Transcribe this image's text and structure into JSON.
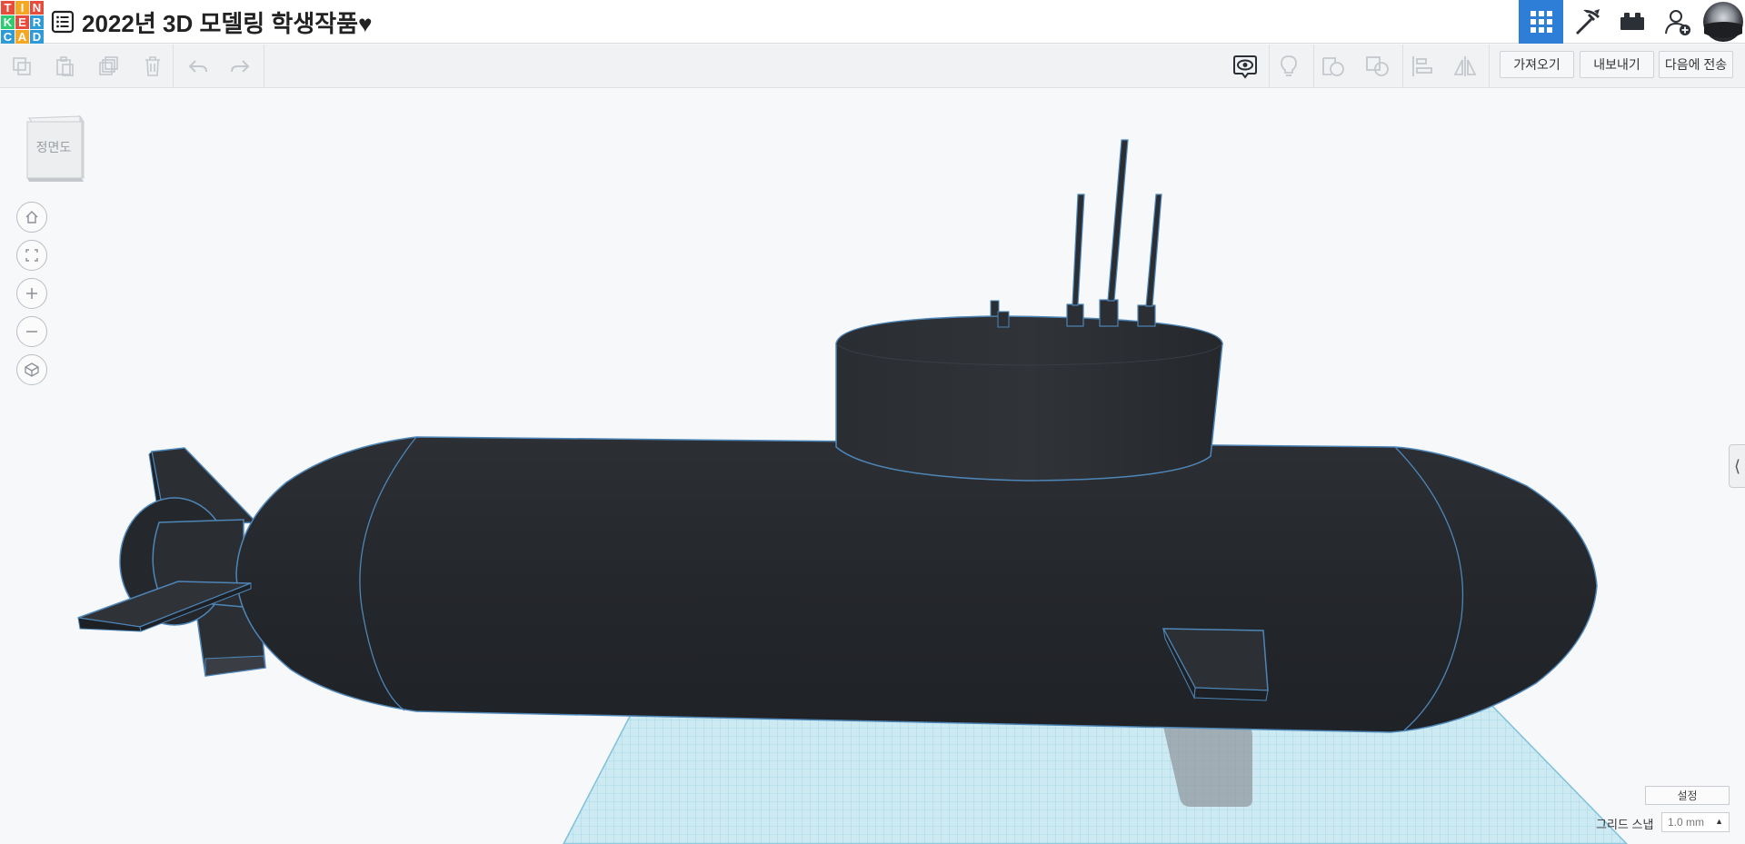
{
  "header": {
    "logo_letters": [
      "T",
      "I",
      "N",
      "K",
      "E",
      "R",
      "C",
      "A",
      "D"
    ],
    "logo_colors": [
      "#e84c3d",
      "#f5a623",
      "#e84c3d",
      "#2ecc71",
      "#e84c3d",
      "#2e9bd6",
      "#2e9bd6",
      "#f5a623",
      "#2e9bd6"
    ],
    "title": "2022년 3D 모델링 학생작품♥",
    "icons": [
      "grid-view-icon",
      "pickaxe-icon",
      "bricks-icon",
      "add-user-icon",
      "avatar"
    ]
  },
  "toolbar": {
    "icons": [
      "copy-icon",
      "paste-icon",
      "duplicate-icon",
      "delete-icon",
      "undo-icon",
      "redo-icon",
      "show-all-icon",
      "light-bulb-icon",
      "group-icon",
      "ungroup-icon",
      "align-icon",
      "mirror-icon"
    ],
    "import_label": "가져오기",
    "export_label": "내보내기",
    "send_label": "다음에 전송"
  },
  "viewcube": {
    "label": "정면도"
  },
  "nav": {
    "icons": [
      "home-view-icon",
      "fit-view-icon",
      "zoom-in-icon",
      "zoom-out-icon",
      "perspective-icon"
    ]
  },
  "bottom": {
    "settings_label": "설정",
    "snap_label": "그리드 스냅",
    "snap_value": "1.0 mm"
  },
  "colors": {
    "accent": "#2e7dd7",
    "model": "#25282d",
    "edge": "#4e86b8",
    "grid": "#a7d8ea"
  }
}
